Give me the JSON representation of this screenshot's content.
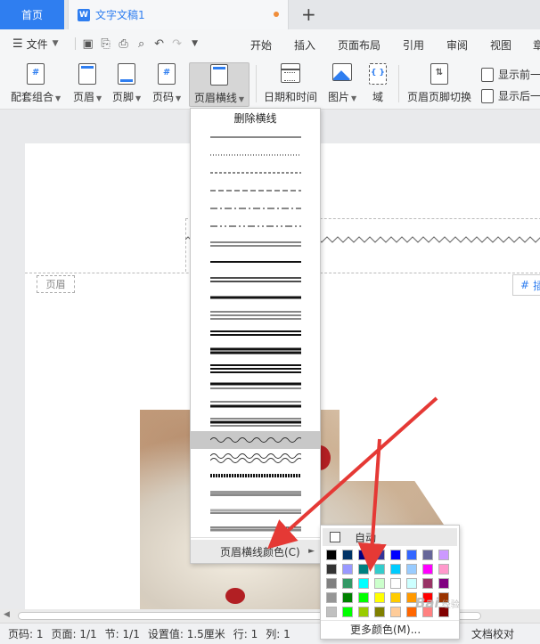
{
  "tabs": {
    "home": "首页",
    "doc_title": "文字文稿1",
    "add": "+"
  },
  "menubar": {
    "file_label": "文件",
    "items": [
      "开始",
      "插入",
      "页面布局",
      "引用",
      "审阅",
      "视图",
      "章"
    ]
  },
  "ribbon": {
    "buttons": [
      "配套组合",
      "页眉",
      "页脚",
      "页码",
      "页眉横线",
      "日期和时间",
      "图片",
      "域",
      "页眉页脚切换"
    ],
    "show_prev": "显示前一",
    "show_next": "显示后一"
  },
  "document": {
    "header_tag": "页眉",
    "page_num_button": "插"
  },
  "dropdown": {
    "delete_line": "删除横线",
    "line_color": "页眉横线颜色(C)",
    "line_style_count": 23,
    "selected_style_index": 17
  },
  "color_picker": {
    "auto": "自动",
    "more_colors": "更多颜色(M)...",
    "swatches": [
      "#000000",
      "#003366",
      "#000080",
      "#333399",
      "#0000ff",
      "#3366ff",
      "#666699",
      "#cc99ff",
      "#333333",
      "#9999ff",
      "#008080",
      "#33cccc",
      "#00ccff",
      "#99ccff",
      "#ff00ff",
      "#ff99cc",
      "#808080",
      "#339966",
      "#00ffff",
      "#ccffcc",
      "#ffffff",
      "#ccffff",
      "#993366",
      "#800080",
      "#969696",
      "#008000",
      "#00ff00",
      "#ffff00",
      "#ffcc00",
      "#ff9900",
      "#ff0000",
      "#993300",
      "#c0c0c0",
      "#00ff00",
      "#99cc00",
      "#808000",
      "#ffcc99",
      "#ff6600",
      "#ff8080",
      "#800000"
    ]
  },
  "statusbar": {
    "page_num": "页码: 1",
    "pages": "页面: 1/1",
    "section": "节: 1/1",
    "setting": "设置值: 1.5厘米",
    "row": "行: 1",
    "col": "列: 1",
    "proof": "文档校对"
  },
  "watermark": {
    "text": "Bai",
    "suffix": "经验"
  },
  "colors": {
    "accent": "#2f7ef0",
    "arrow": "#e53935"
  }
}
